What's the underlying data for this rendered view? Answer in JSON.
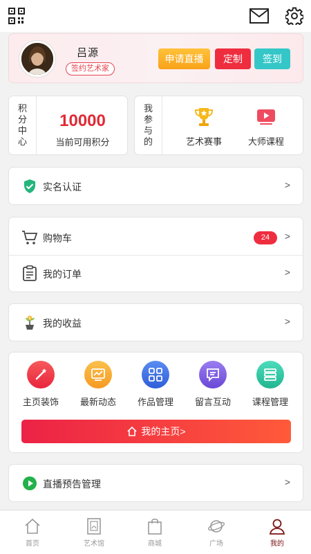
{
  "topbar": {
    "qr_icon": "qr-code-icon",
    "mail_icon": "mail-icon",
    "settings_icon": "gear-icon"
  },
  "profile": {
    "name": "吕源",
    "badge": "签约艺术家",
    "buttons": {
      "live": "申请直播",
      "custom": "定制",
      "sign_in": "签到"
    },
    "colors": {
      "live": "#F8A21A",
      "custom": "#EE2D3F",
      "sign_in": "#35C7C8"
    }
  },
  "points": {
    "label": [
      "积",
      "分",
      "中",
      "心"
    ],
    "value": "10000",
    "caption": "当前可用积分"
  },
  "participation": {
    "label": [
      "我",
      "参",
      "与",
      "的"
    ],
    "items": [
      {
        "label": "艺术赛事",
        "icon": "trophy-icon"
      },
      {
        "label": "大师课程",
        "icon": "video-play-icon"
      }
    ]
  },
  "verify": {
    "label": "实名认证",
    "arrow": ">",
    "icon": "shield-check-icon"
  },
  "shopping": {
    "cart": {
      "label": "购物车",
      "count": "24",
      "arrow": ">",
      "icon": "cart-icon"
    },
    "orders": {
      "label": "我的订单",
      "arrow": ">",
      "icon": "order-list-icon"
    }
  },
  "income": {
    "label": "我的收益",
    "arrow": ">",
    "icon": "money-plant-icon"
  },
  "tools": {
    "items": [
      {
        "label": "主页装饰",
        "icon": "magic-wand-icon",
        "color": "#EF3B47"
      },
      {
        "label": "最新动态",
        "icon": "trend-chart-icon",
        "color": "#F7A233"
      },
      {
        "label": "作品管理",
        "icon": "grid-icon",
        "color": "#3E6FE0"
      },
      {
        "label": "留言互动",
        "icon": "message-icon",
        "color": "#7C5BE1"
      },
      {
        "label": "课程管理",
        "icon": "books-icon",
        "color": "#2DC6A4"
      }
    ],
    "home_button": "我的主页>"
  },
  "live_preview": {
    "label": "直播预告管理",
    "arrow": ">",
    "icon": "play-circle-icon"
  },
  "tabbar": {
    "items": [
      {
        "label": "首页",
        "icon": "home-icon"
      },
      {
        "label": "艺术馆",
        "icon": "gallery-icon"
      },
      {
        "label": "商城",
        "icon": "shopping-bag-icon"
      },
      {
        "label": "广场",
        "icon": "planet-icon"
      },
      {
        "label": "我的",
        "icon": "user-icon"
      }
    ],
    "active_index": 4,
    "active_color": "#7A1212"
  }
}
